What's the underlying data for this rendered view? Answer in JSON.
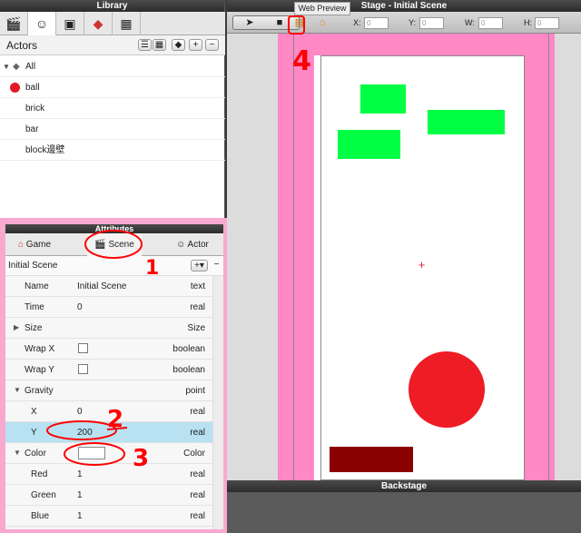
{
  "library": {
    "title": "Library",
    "tab_icons": [
      "clapboard-icon",
      "mask-icon",
      "image-icon",
      "palette-icon",
      "table-icon"
    ],
    "actors_label": "Actors",
    "actor_buttons": [
      "list-view",
      "grid-view",
      "tag",
      "+",
      "−"
    ],
    "items": [
      {
        "label": "All",
        "icon": "tag-icon"
      },
      {
        "label": "ball",
        "icon": "red-circle-icon"
      },
      {
        "label": "brick"
      },
      {
        "label": "bar"
      },
      {
        "label": "block邊壁"
      }
    ]
  },
  "attributes": {
    "title": "Attributes",
    "tabs": [
      "Game",
      "Scene",
      "Actor"
    ],
    "scene_name": "Initial Scene",
    "add_label": "+▾",
    "remove_label": "−",
    "rows": [
      {
        "name": "Name",
        "value": "Initial Scene",
        "type": "text"
      },
      {
        "name": "Time",
        "value": "0",
        "type": "real"
      },
      {
        "name": "Size",
        "value": "",
        "type": "Size"
      },
      {
        "name": "Wrap X",
        "value": "",
        "type": "boolean"
      },
      {
        "name": "Wrap Y",
        "value": "",
        "type": "boolean"
      },
      {
        "name": "Gravity",
        "value": "",
        "type": "point"
      },
      {
        "name": "X",
        "value": "0",
        "type": "real"
      },
      {
        "name": "Y",
        "value": "200",
        "type": "real"
      },
      {
        "name": "Color",
        "value": "",
        "type": "Color"
      },
      {
        "name": "Red",
        "value": "1",
        "type": "real"
      },
      {
        "name": "Green",
        "value": "1",
        "type": "real"
      },
      {
        "name": "Blue",
        "value": "1",
        "type": "real"
      }
    ]
  },
  "stage": {
    "title": "Stage - Initial Scene",
    "tooltip": "Web Preview",
    "coords": [
      {
        "label": "X:",
        "value": "0"
      },
      {
        "label": "Y:",
        "value": "0"
      },
      {
        "label": "W:",
        "value": "0"
      },
      {
        "label": "H:",
        "value": "0"
      }
    ],
    "tools": [
      "arrow-icon",
      "camera-icon",
      "web-preview-icon",
      "home-icon"
    ],
    "colors": {
      "pink": "#ff88c5",
      "brick": "#00ff44",
      "ball": "#ee1c25",
      "bar": "#8b0000"
    }
  },
  "backstage": {
    "title": "Backstage"
  },
  "annotations": [
    "1",
    "2",
    "3",
    "4"
  ]
}
